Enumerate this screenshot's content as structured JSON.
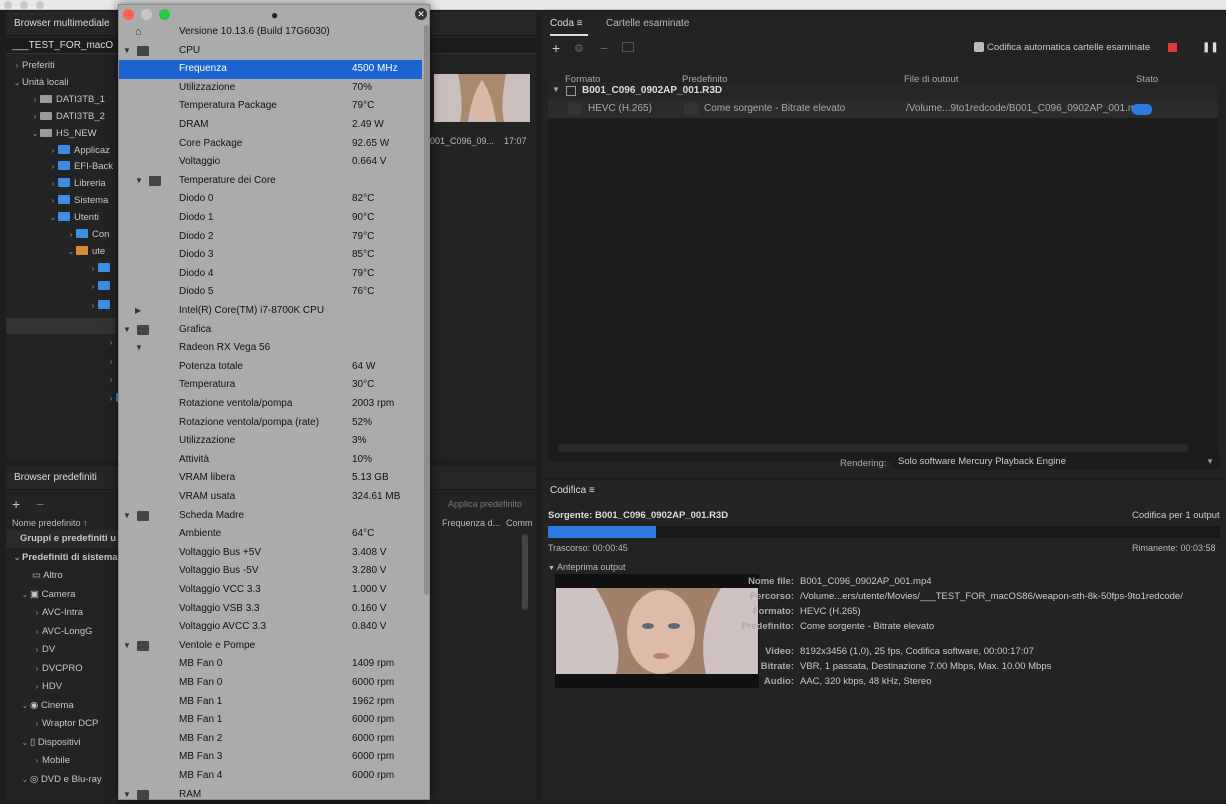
{
  "left_panel": {
    "title": "Browser multimediale",
    "path": "___TEST_FOR_macO",
    "tree": [
      {
        "label": "Preferiti",
        "type": "chev"
      },
      {
        "label": "Unità locali",
        "type": "chev"
      },
      {
        "label": "DATI3TB_1",
        "type": "drive"
      },
      {
        "label": "DATI3TB_2",
        "type": "drive"
      },
      {
        "label": "HS_NEW",
        "type": "drive"
      },
      {
        "label": "Applicaz",
        "type": "folder"
      },
      {
        "label": "EFI-Back",
        "type": "folder"
      },
      {
        "label": "Libreria",
        "type": "folder"
      },
      {
        "label": "Sistema",
        "type": "folder"
      },
      {
        "label": "Utenti",
        "type": "folder"
      },
      {
        "label": "Con",
        "type": "folder"
      },
      {
        "label": "ute",
        "type": "home"
      }
    ]
  },
  "media": {
    "clip_name": "001_C096_09...",
    "duration": "17:07"
  },
  "presets_panel": {
    "title": "Browser predefiniti",
    "apply_label": "Applica predefinito",
    "col_name": "Nome predefinito",
    "col_freq": "Frequenza d...",
    "col_comm": "Comm",
    "rows": [
      {
        "label": "Gruppi e predefiniti u"
      },
      {
        "label": "Predefiniti di sistema"
      },
      {
        "label": "Altro"
      },
      {
        "label": "Camera"
      },
      {
        "label": "AVC-Intra"
      },
      {
        "label": "AVC-LongG"
      },
      {
        "label": "DV"
      },
      {
        "label": "DVCPRO"
      },
      {
        "label": "HDV"
      },
      {
        "label": "Cinema"
      },
      {
        "label": "Wraptor DCP"
      },
      {
        "label": "Dispositivi"
      },
      {
        "label": "Mobile"
      },
      {
        "label": "DVD e Blu-ray"
      }
    ]
  },
  "hwmonitor": {
    "rows": [
      {
        "label": "Versione 10.13.6 (Build 17G6030)",
        "value": ""
      },
      {
        "label": "CPU",
        "value": ""
      },
      {
        "label": "Frequenza",
        "value": "4500 MHz"
      },
      {
        "label": "Utilizzazione",
        "value": "70%"
      },
      {
        "label": "Temperatura Package",
        "value": "79°C"
      },
      {
        "label": "DRAM",
        "value": "2.49 W"
      },
      {
        "label": "Core Package",
        "value": "92.65 W"
      },
      {
        "label": "Voltaggio",
        "value": "0.664 V"
      },
      {
        "label": "Temperature dei Core",
        "value": ""
      },
      {
        "label": "Diodo 0",
        "value": "82°C"
      },
      {
        "label": "Diodo 1",
        "value": "90°C"
      },
      {
        "label": "Diodo 2",
        "value": "79°C"
      },
      {
        "label": "Diodo 3",
        "value": "85°C"
      },
      {
        "label": "Diodo 4",
        "value": "79°C"
      },
      {
        "label": "Diodo 5",
        "value": "76°C"
      },
      {
        "label": "Intel(R) Core(TM) i7-8700K CPU",
        "value": ""
      },
      {
        "label": "Grafica",
        "value": ""
      },
      {
        "label": "Radeon RX Vega 56",
        "value": ""
      },
      {
        "label": "Potenza totale",
        "value": "64 W"
      },
      {
        "label": "Temperatura",
        "value": "30°C"
      },
      {
        "label": "Rotazione ventola/pompa",
        "value": "2003 rpm"
      },
      {
        "label": "Rotazione ventola/pompa (rate)",
        "value": "52%"
      },
      {
        "label": "Utilizzazione",
        "value": "3%"
      },
      {
        "label": "Attività",
        "value": "10%"
      },
      {
        "label": "VRAM libera",
        "value": "5.13 GB"
      },
      {
        "label": "VRAM usata",
        "value": "324.61 MB"
      },
      {
        "label": "Scheda Madre",
        "value": ""
      },
      {
        "label": "Ambiente",
        "value": "64°C"
      },
      {
        "label": "Voltaggio Bus +5V",
        "value": "3.408 V"
      },
      {
        "label": "Voltaggio Bus -5V",
        "value": "3.280 V"
      },
      {
        "label": "Voltaggio VCC 3.3",
        "value": "1.000 V"
      },
      {
        "label": "Voltaggio VSB 3.3",
        "value": "0.160 V"
      },
      {
        "label": "Voltaggio AVCC 3.3",
        "value": "0.840 V"
      },
      {
        "label": "Ventole e Pompe",
        "value": ""
      },
      {
        "label": "MB Fan 0",
        "value": "1409 rpm"
      },
      {
        "label": "MB Fan 0",
        "value": "6000 rpm"
      },
      {
        "label": "MB Fan 1",
        "value": "1962 rpm"
      },
      {
        "label": "MB Fan 1",
        "value": "6000 rpm"
      },
      {
        "label": "MB Fan 2",
        "value": "6000 rpm"
      },
      {
        "label": "MB Fan 3",
        "value": "6000 rpm"
      },
      {
        "label": "MB Fan 4",
        "value": "6000 rpm"
      },
      {
        "label": "RAM",
        "value": ""
      }
    ]
  },
  "queue": {
    "tab_queue": "Coda",
    "tab_folders": "Cartelle esaminate",
    "auto_encode": "Codifica automatica cartelle esaminate",
    "col_format": "Formato",
    "col_preset": "Predefinito",
    "col_output": "File di output",
    "col_status": "Stato",
    "source": "B001_C096_0902AP_001.R3D",
    "format": "HEVC (H.265)",
    "preset": "Come sorgente - Bitrate elevato",
    "output": "/Volume...9to1redcode/B001_C096_0902AP_001.mp4",
    "rendering_label": "Rendering:",
    "rendering_value": "Solo software Mercury Playback Engine",
    "progress": 0.5
  },
  "encoding": {
    "title": "Codifica",
    "source_line": "Sorgente: B001_C096_0902AP_001.R3D",
    "count": "Codifica per 1 output",
    "elapsed": "Trascorso: 00:00:45",
    "remaining": "Rimanente: 00:03:58",
    "preview_label": "Anteprima output",
    "progress": 0.16,
    "info": [
      {
        "k": "Nome file:",
        "v": "B001_C096_0902AP_001.mp4"
      },
      {
        "k": "Percorso:",
        "v": "/Volume...ers/utente/Movies/___TEST_FOR_macOS86/weapon-sth-8k-50fps-9to1redcode/"
      },
      {
        "k": "Formato:",
        "v": "HEVC (H.265)"
      },
      {
        "k": "Predefinito:",
        "v": "Come sorgente - Bitrate elevato"
      },
      {
        "k": "Video:",
        "v": "8192x3456 (1,0), 25 fps, Codifica software, 00:00:17:07"
      },
      {
        "k": "Bitrate:",
        "v": "VBR, 1 passata, Destinazione 7.00 Mbps, Max. 10.00 Mbps"
      },
      {
        "k": "Audio:",
        "v": "AAC, 320 kbps, 48 kHz, Stereo"
      }
    ]
  },
  "colors": {
    "accent": "#2d7be0",
    "selection": "#1a63d1",
    "stop": "#e03a3a"
  }
}
